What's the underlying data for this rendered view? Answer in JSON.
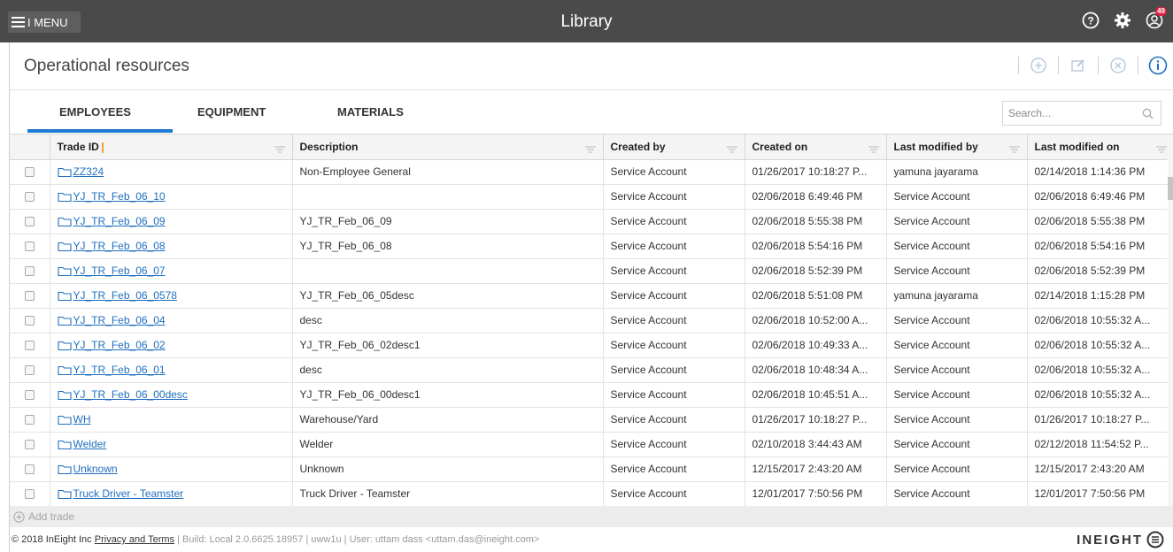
{
  "topbar": {
    "menu_label": "I MENU",
    "app_title": "Library",
    "notification_count": "49"
  },
  "page": {
    "title": "Operational resources"
  },
  "tabs": [
    {
      "label": "EMPLOYEES",
      "active": true
    },
    {
      "label": "EQUIPMENT",
      "active": false
    },
    {
      "label": "MATERIALS",
      "active": false
    }
  ],
  "search": {
    "placeholder": "Search...",
    "value": ""
  },
  "table": {
    "columns": [
      "Trade ID",
      "Description",
      "Created by",
      "Created on",
      "Last modified by",
      "Last modified on"
    ],
    "rows": [
      [
        "ZZ324",
        "Non-Employee General",
        "Service Account",
        "01/26/2017 10:18:27 P...",
        "yamuna jayarama",
        "02/14/2018 1:14:36 PM"
      ],
      [
        "YJ_TR_Feb_06_10",
        "",
        "Service Account",
        "02/06/2018 6:49:46 PM",
        "Service Account",
        "02/06/2018 6:49:46 PM"
      ],
      [
        "YJ_TR_Feb_06_09",
        "YJ_TR_Feb_06_09",
        "Service Account",
        "02/06/2018 5:55:38 PM",
        "Service Account",
        "02/06/2018 5:55:38 PM"
      ],
      [
        "YJ_TR_Feb_06_08",
        "YJ_TR_Feb_06_08",
        "Service Account",
        "02/06/2018 5:54:16 PM",
        "Service Account",
        "02/06/2018 5:54:16 PM"
      ],
      [
        "YJ_TR_Feb_06_07",
        "",
        "Service Account",
        "02/06/2018 5:52:39 PM",
        "Service Account",
        "02/06/2018 5:52:39 PM"
      ],
      [
        "YJ_TR_Feb_06_0578",
        "YJ_TR_Feb_06_05desc",
        "Service Account",
        "02/06/2018 5:51:08 PM",
        "yamuna jayarama",
        "02/14/2018 1:15:28 PM"
      ],
      [
        "YJ_TR_Feb_06_04",
        "desc",
        "Service Account",
        "02/06/2018 10:52:00 A...",
        "Service Account",
        "02/06/2018 10:55:32 A..."
      ],
      [
        "YJ_TR_Feb_06_02",
        "YJ_TR_Feb_06_02desc1",
        "Service Account",
        "02/06/2018 10:49:33 A...",
        "Service Account",
        "02/06/2018 10:55:32 A..."
      ],
      [
        "YJ_TR_Feb_06_01",
        "desc",
        "Service Account",
        "02/06/2018 10:48:34 A...",
        "Service Account",
        "02/06/2018 10:55:32 A..."
      ],
      [
        "YJ_TR_Feb_06_00desc",
        "YJ_TR_Feb_06_00desc1",
        "Service Account",
        "02/06/2018 10:45:51 A...",
        "Service Account",
        "02/06/2018 10:55:32 A..."
      ],
      [
        "WH",
        "Warehouse/Yard",
        "Service Account",
        "01/26/2017 10:18:27 P...",
        "Service Account",
        "01/26/2017 10:18:27 P..."
      ],
      [
        "Welder",
        "Welder",
        "Service Account",
        "02/10/2018 3:44:43 AM",
        "Service Account",
        "02/12/2018 11:54:52 P..."
      ],
      [
        "Unknown",
        "Unknown",
        "Service Account",
        "12/15/2017 2:43:20 AM",
        "Service Account",
        "12/15/2017 2:43:20 AM"
      ],
      [
        "Truck Driver - Teamster",
        "Truck Driver - Teamster",
        "Service Account",
        "12/01/2017 7:50:56 PM",
        "Service Account",
        "12/01/2017 7:50:56 PM"
      ]
    ]
  },
  "add_trade_label": "Add trade",
  "footer": {
    "copyright": "2018 InEight Inc",
    "privacy_link": "Privacy and Terms",
    "build_info": "| Build: Local 2.0.6625.18957 | uww1u | User: uttam dass <uttam.das@ineight.com>",
    "logo_text": "INEIGHT"
  },
  "colors": {
    "topbar_bg": "#4a4a4a",
    "accent": "#1f7ad3",
    "link": "#1f6fbf",
    "badge": "#e0213f"
  }
}
